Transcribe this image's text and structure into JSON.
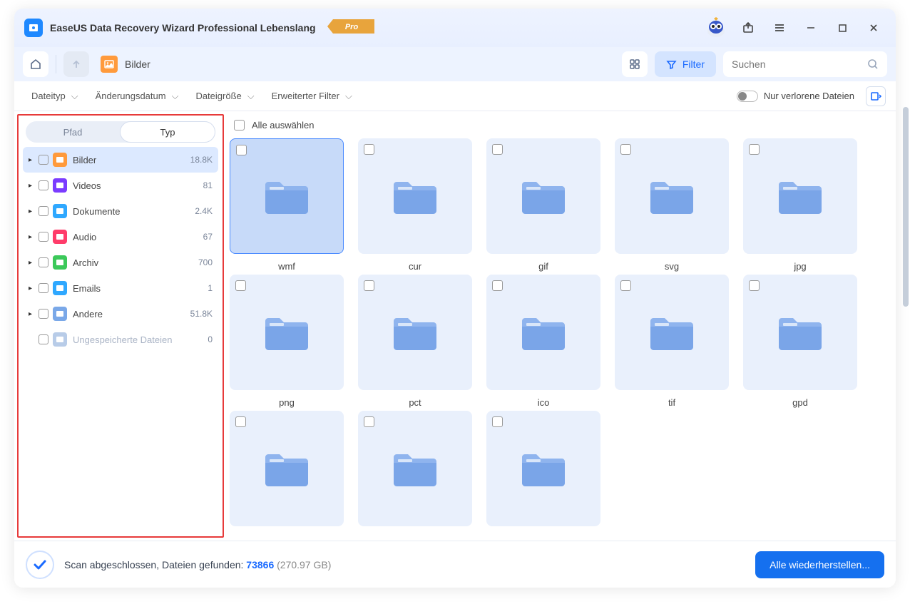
{
  "titlebar": {
    "app_title": "EaseUS Data Recovery Wizard Professional Lebenslang",
    "pro_label": "Pro"
  },
  "toolbar": {
    "location_label": "Bilder",
    "filter_label": "Filter",
    "search_placeholder": "Suchen"
  },
  "filterbar": {
    "items": [
      "Dateityp",
      "Änderungsdatum",
      "Dateigröße",
      "Erweiterter Filter"
    ],
    "lost_only_label": "Nur verlorene Dateien"
  },
  "sidebar": {
    "tabs": {
      "path": "Pfad",
      "type": "Typ"
    },
    "items": [
      {
        "icon_bg": "#ff9a3c",
        "label": "Bilder",
        "count": "18.8K",
        "selected": true
      },
      {
        "icon_bg": "#7b3cff",
        "label": "Videos",
        "count": "81",
        "selected": false
      },
      {
        "icon_bg": "#2fa8ff",
        "label": "Dokumente",
        "count": "2.4K",
        "selected": false
      },
      {
        "icon_bg": "#ff3c6a",
        "label": "Audio",
        "count": "67",
        "selected": false
      },
      {
        "icon_bg": "#3cc95a",
        "label": "Archiv",
        "count": "700",
        "selected": false
      },
      {
        "icon_bg": "#2fa8ff",
        "label": "Emails",
        "count": "1",
        "selected": false
      },
      {
        "icon_bg": "#7aa8e8",
        "label": "Andere",
        "count": "51.8K",
        "selected": false
      },
      {
        "icon_bg": "#b8cce8",
        "label": "Ungespeicherte Dateien",
        "count": "0",
        "selected": false,
        "no_arrow": true,
        "muted": true
      }
    ]
  },
  "main": {
    "select_all_label": "Alle auswählen",
    "folders": [
      {
        "label": "wmf",
        "selected": true
      },
      {
        "label": "cur"
      },
      {
        "label": "gif"
      },
      {
        "label": "svg"
      },
      {
        "label": "jpg"
      },
      {
        "label": "png"
      },
      {
        "label": "pct"
      },
      {
        "label": "ico"
      },
      {
        "label": "tif"
      },
      {
        "label": "gpd"
      },
      {
        "label": ""
      },
      {
        "label": ""
      },
      {
        "label": ""
      }
    ]
  },
  "footer": {
    "status_prefix": "Scan abgeschlossen, Dateien gefunden: ",
    "count": "73866",
    "size": " (270.97 GB)",
    "recover_label": "Alle wiederherstellen..."
  }
}
